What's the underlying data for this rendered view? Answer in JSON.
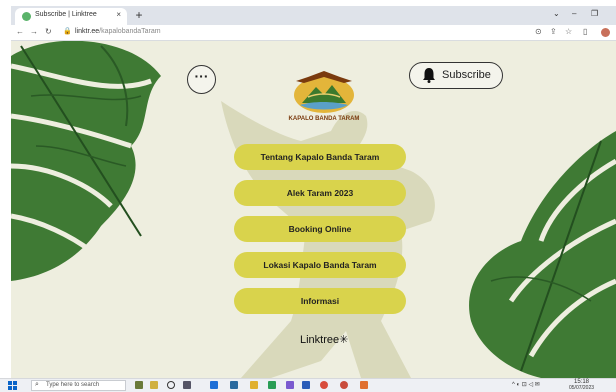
{
  "browser": {
    "tab_title": "Subscribe | Linktree",
    "tab_close": "×",
    "new_tab": "+",
    "minimize": "⌄",
    "window_min": "–",
    "window_max": "❐",
    "url_host": "linktr.ee",
    "url_path": "/kapalobandaTaram"
  },
  "page": {
    "menu_label": "···",
    "subscribe_label": "Subscribe",
    "logo_text": "KAPALO BANDA TARAM",
    "links": [
      {
        "label": "Tentang Kapalo Banda Taram"
      },
      {
        "label": "Alek Taram 2023"
      },
      {
        "label": "Booking Online"
      },
      {
        "label": "Lokasi Kapalo Banda Taram"
      },
      {
        "label": "Informasi"
      }
    ],
    "footer": "Linktree✳",
    "colors": {
      "link_bg": "#d9d34c",
      "page_bg": "#eeeedf",
      "leaf": "#2f6b2a"
    }
  },
  "taskbar": {
    "search_placeholder": "Type here to search",
    "tray_time": "15:18",
    "tray_date": "05/07/2023"
  }
}
